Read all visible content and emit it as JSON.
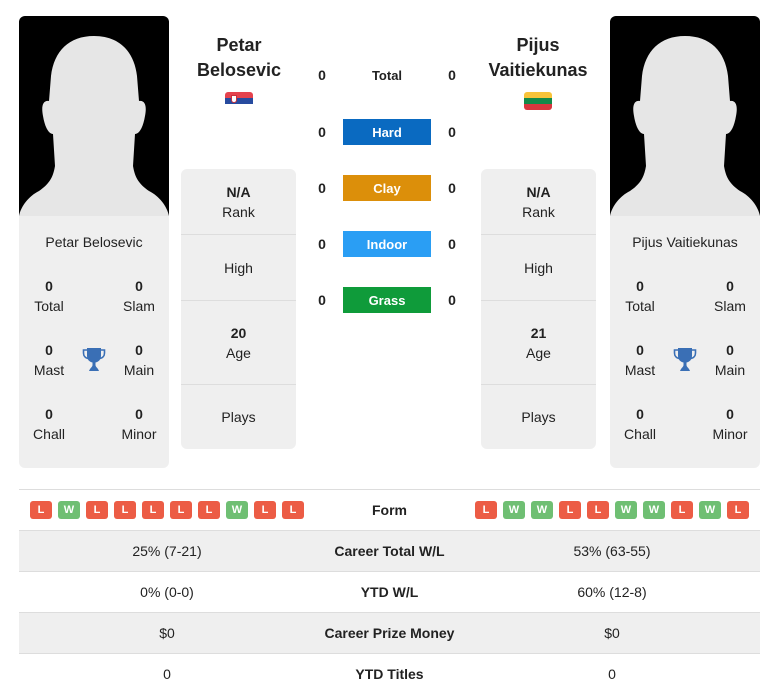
{
  "player1": {
    "name_line1": "Petar",
    "name_line2": "Belosevic",
    "full_name": "Petar Belosevic",
    "flag": "serbia-flag",
    "titles": {
      "total": "0",
      "slam": "0",
      "mast": "0",
      "main": "0",
      "chall": "0",
      "minor": "0"
    },
    "rank_value": "N/A",
    "high_value": "",
    "age_value": "20",
    "plays_value": "",
    "form": [
      "L",
      "W",
      "L",
      "L",
      "L",
      "L",
      "L",
      "W",
      "L",
      "L"
    ]
  },
  "player2": {
    "name_line1": "Pijus",
    "name_line2": "Vaitiekunas",
    "full_name": "Pijus Vaitiekunas",
    "flag": "lithuania-flag",
    "titles": {
      "total": "0",
      "slam": "0",
      "mast": "0",
      "main": "0",
      "chall": "0",
      "minor": "0"
    },
    "rank_value": "N/A",
    "high_value": "",
    "age_value": "21",
    "plays_value": "",
    "form": [
      "L",
      "W",
      "W",
      "L",
      "L",
      "W",
      "W",
      "L",
      "W",
      "L"
    ]
  },
  "labels": {
    "total": "Total",
    "slam": "Slam",
    "mast": "Mast",
    "main": "Main",
    "chall": "Chall",
    "minor": "Minor",
    "rank": "Rank",
    "high": "High",
    "age": "Age",
    "plays": "Plays"
  },
  "h2h": {
    "total": {
      "label": "Total",
      "p1": "0",
      "p2": "0"
    },
    "surfaces": [
      {
        "label": "Hard",
        "p1": "0",
        "p2": "0",
        "color": "#0a6ac1"
      },
      {
        "label": "Clay",
        "p1": "0",
        "p2": "0",
        "color": "#dc8f0a"
      },
      {
        "label": "Indoor",
        "p1": "0",
        "p2": "0",
        "color": "#2a9ef4"
      },
      {
        "label": "Grass",
        "p1": "0",
        "p2": "0",
        "color": "#0f9b3a"
      }
    ]
  },
  "comparison": {
    "form_label": "Form",
    "rows": [
      {
        "label": "Career Total W/L",
        "p1": "25% (7-21)",
        "p2": "53% (63-55)"
      },
      {
        "label": "YTD W/L",
        "p1": "0% (0-0)",
        "p2": "60% (12-8)"
      },
      {
        "label": "Career Prize Money",
        "p1": "$0",
        "p2": "$0"
      },
      {
        "label": "YTD Titles",
        "p1": "0",
        "p2": "0"
      }
    ]
  },
  "colors": {
    "loss": "#ec5c45",
    "win": "#6fbf73",
    "trophy": "#3a6fb5"
  }
}
